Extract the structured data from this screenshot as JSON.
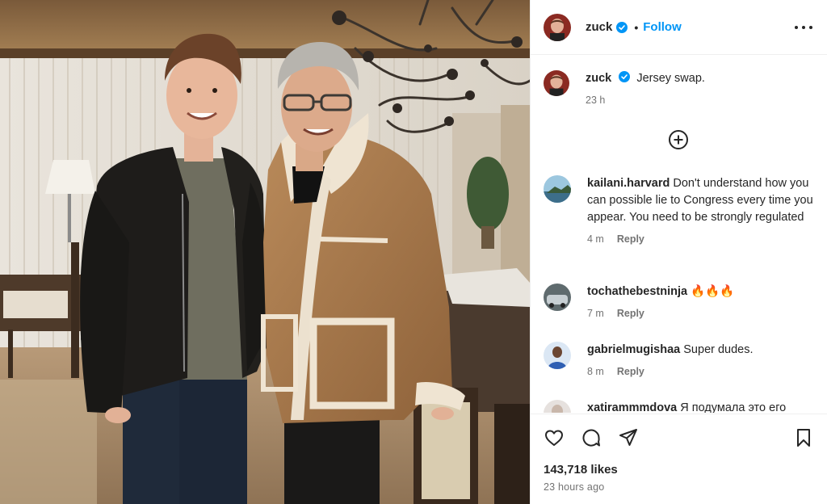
{
  "post": {
    "author": "zuck",
    "follow_label": "Follow",
    "separator": "•",
    "caption": {
      "username": "zuck",
      "text": "Jersey swap.",
      "time": "23 h"
    }
  },
  "comments": [
    {
      "username": "kailani.harvard",
      "text": "Don't understand how you can possible lie to Congress every time you appear. You need to be strongly regulated",
      "time": "4 m",
      "reply_label": "Reply",
      "avatar_color": "#7fb6d4"
    },
    {
      "username": "tochathebestninja",
      "text": "🔥🔥🔥",
      "time": "7 m",
      "reply_label": "Reply",
      "avatar_color": "#6d6a5e"
    },
    {
      "username": "gabrielmugishaa",
      "text": "Super dudes.",
      "time": "8 m",
      "reply_label": "Reply",
      "avatar_color": "#4a7fc9"
    },
    {
      "username": "xatirammmdova",
      "text": "Я подумала это его",
      "avatar_color": "#d8d4d2"
    }
  ],
  "stats": {
    "likes": "143,718 likes",
    "posted": "23 hours ago"
  },
  "icons": {
    "more": "more-options-icon",
    "verified": "verified-badge-icon",
    "load_more": "plus-circle-icon",
    "like": "heart-icon",
    "comment": "comment-icon",
    "share": "share-icon",
    "save": "bookmark-icon"
  },
  "colors": {
    "accent": "#0095f6",
    "verified": "#0095f6",
    "text": "#262626",
    "muted": "#737373"
  }
}
